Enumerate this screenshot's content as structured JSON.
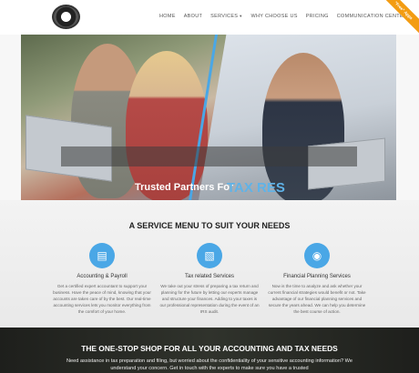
{
  "nav": {
    "items": [
      "Home",
      "About",
      "Services",
      "Why Choose Us",
      "Pricing",
      "Communication Center"
    ],
    "dropdown_caret": "▼"
  },
  "ribbon": "\"Free\" Apps",
  "hero": {
    "tagline": "Trusted Partners For",
    "tagline_accent": "TAX RES"
  },
  "services": {
    "title": "A Service Menu to Suit Your Needs",
    "items": [
      {
        "icon": "document-icon",
        "title": "Accounting & Payroll",
        "desc": "Get a certified expert accountant to support your business. Have the peace of mind, knowing that your accounts are taken care of by the best. Our real-time accounting services lets you monitor everything from the comfort of your home."
      },
      {
        "icon": "laptop-icon",
        "title": "Tax related Services",
        "desc": "We take out your stress of preparing a tax return and planning for the future by letting our experts manage and structure your finances. Adding to your taxes is our professional representation during the event of an IRS audit."
      },
      {
        "icon": "globe-icon",
        "title": "Financial Planning Services",
        "desc": "Now is the time to analyze and ask whether your current financial strategies would benefit or not. Take advantage of our financial planning services and secure the years ahead. We can help you determine the best course of action."
      }
    ]
  },
  "footer": {
    "title": "The One-Stop Shop for All Your Accounting and Tax Needs",
    "text": "Need assistance in tax preparation and filing, but worried about the confidentiality of your sensitive accounting information? We understand your concern. Get in touch with the experts to make sure you have a trusted"
  }
}
